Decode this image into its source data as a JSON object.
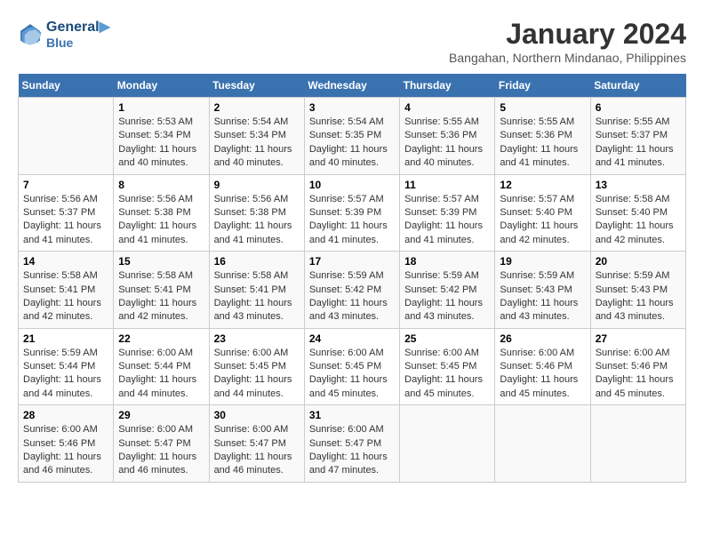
{
  "header": {
    "logo_line1": "General",
    "logo_line2": "Blue",
    "month": "January 2024",
    "location": "Bangahan, Northern Mindanao, Philippines"
  },
  "weekdays": [
    "Sunday",
    "Monday",
    "Tuesday",
    "Wednesday",
    "Thursday",
    "Friday",
    "Saturday"
  ],
  "weeks": [
    [
      {
        "day": "",
        "info": ""
      },
      {
        "day": "1",
        "info": "Sunrise: 5:53 AM\nSunset: 5:34 PM\nDaylight: 11 hours\nand 40 minutes."
      },
      {
        "day": "2",
        "info": "Sunrise: 5:54 AM\nSunset: 5:34 PM\nDaylight: 11 hours\nand 40 minutes."
      },
      {
        "day": "3",
        "info": "Sunrise: 5:54 AM\nSunset: 5:35 PM\nDaylight: 11 hours\nand 40 minutes."
      },
      {
        "day": "4",
        "info": "Sunrise: 5:55 AM\nSunset: 5:36 PM\nDaylight: 11 hours\nand 40 minutes."
      },
      {
        "day": "5",
        "info": "Sunrise: 5:55 AM\nSunset: 5:36 PM\nDaylight: 11 hours\nand 41 minutes."
      },
      {
        "day": "6",
        "info": "Sunrise: 5:55 AM\nSunset: 5:37 PM\nDaylight: 11 hours\nand 41 minutes."
      }
    ],
    [
      {
        "day": "7",
        "info": "Sunrise: 5:56 AM\nSunset: 5:37 PM\nDaylight: 11 hours\nand 41 minutes."
      },
      {
        "day": "8",
        "info": "Sunrise: 5:56 AM\nSunset: 5:38 PM\nDaylight: 11 hours\nand 41 minutes."
      },
      {
        "day": "9",
        "info": "Sunrise: 5:56 AM\nSunset: 5:38 PM\nDaylight: 11 hours\nand 41 minutes."
      },
      {
        "day": "10",
        "info": "Sunrise: 5:57 AM\nSunset: 5:39 PM\nDaylight: 11 hours\nand 41 minutes."
      },
      {
        "day": "11",
        "info": "Sunrise: 5:57 AM\nSunset: 5:39 PM\nDaylight: 11 hours\nand 41 minutes."
      },
      {
        "day": "12",
        "info": "Sunrise: 5:57 AM\nSunset: 5:40 PM\nDaylight: 11 hours\nand 42 minutes."
      },
      {
        "day": "13",
        "info": "Sunrise: 5:58 AM\nSunset: 5:40 PM\nDaylight: 11 hours\nand 42 minutes."
      }
    ],
    [
      {
        "day": "14",
        "info": "Sunrise: 5:58 AM\nSunset: 5:41 PM\nDaylight: 11 hours\nand 42 minutes."
      },
      {
        "day": "15",
        "info": "Sunrise: 5:58 AM\nSunset: 5:41 PM\nDaylight: 11 hours\nand 42 minutes."
      },
      {
        "day": "16",
        "info": "Sunrise: 5:58 AM\nSunset: 5:41 PM\nDaylight: 11 hours\nand 43 minutes."
      },
      {
        "day": "17",
        "info": "Sunrise: 5:59 AM\nSunset: 5:42 PM\nDaylight: 11 hours\nand 43 minutes."
      },
      {
        "day": "18",
        "info": "Sunrise: 5:59 AM\nSunset: 5:42 PM\nDaylight: 11 hours\nand 43 minutes."
      },
      {
        "day": "19",
        "info": "Sunrise: 5:59 AM\nSunset: 5:43 PM\nDaylight: 11 hours\nand 43 minutes."
      },
      {
        "day": "20",
        "info": "Sunrise: 5:59 AM\nSunset: 5:43 PM\nDaylight: 11 hours\nand 43 minutes."
      }
    ],
    [
      {
        "day": "21",
        "info": "Sunrise: 5:59 AM\nSunset: 5:44 PM\nDaylight: 11 hours\nand 44 minutes."
      },
      {
        "day": "22",
        "info": "Sunrise: 6:00 AM\nSunset: 5:44 PM\nDaylight: 11 hours\nand 44 minutes."
      },
      {
        "day": "23",
        "info": "Sunrise: 6:00 AM\nSunset: 5:45 PM\nDaylight: 11 hours\nand 44 minutes."
      },
      {
        "day": "24",
        "info": "Sunrise: 6:00 AM\nSunset: 5:45 PM\nDaylight: 11 hours\nand 45 minutes."
      },
      {
        "day": "25",
        "info": "Sunrise: 6:00 AM\nSunset: 5:45 PM\nDaylight: 11 hours\nand 45 minutes."
      },
      {
        "day": "26",
        "info": "Sunrise: 6:00 AM\nSunset: 5:46 PM\nDaylight: 11 hours\nand 45 minutes."
      },
      {
        "day": "27",
        "info": "Sunrise: 6:00 AM\nSunset: 5:46 PM\nDaylight: 11 hours\nand 45 minutes."
      }
    ],
    [
      {
        "day": "28",
        "info": "Sunrise: 6:00 AM\nSunset: 5:46 PM\nDaylight: 11 hours\nand 46 minutes."
      },
      {
        "day": "29",
        "info": "Sunrise: 6:00 AM\nSunset: 5:47 PM\nDaylight: 11 hours\nand 46 minutes."
      },
      {
        "day": "30",
        "info": "Sunrise: 6:00 AM\nSunset: 5:47 PM\nDaylight: 11 hours\nand 46 minutes."
      },
      {
        "day": "31",
        "info": "Sunrise: 6:00 AM\nSunset: 5:47 PM\nDaylight: 11 hours\nand 47 minutes."
      },
      {
        "day": "",
        "info": ""
      },
      {
        "day": "",
        "info": ""
      },
      {
        "day": "",
        "info": ""
      }
    ]
  ]
}
